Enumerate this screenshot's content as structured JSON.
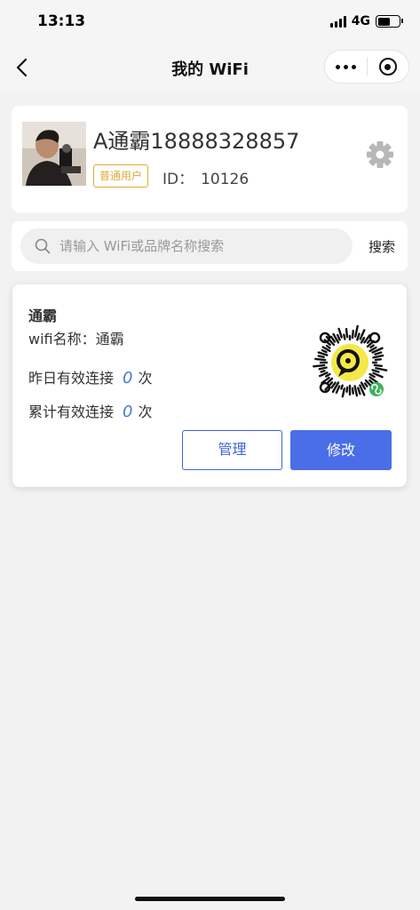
{
  "status_bar": {
    "time": "13:13",
    "network": "4G",
    "battery_level": 0.6
  },
  "nav": {
    "title": "我的 WiFi"
  },
  "profile": {
    "name": "A通霸18888328857",
    "badge": "普通用户",
    "id_label": "ID：",
    "id_value": "10126"
  },
  "search": {
    "placeholder": "请输入 WiFi或品牌名称搜索",
    "value": "",
    "button_label": "搜索"
  },
  "wifi_card": {
    "title": "通霸",
    "wifi_name_label": "wifi名称：",
    "wifi_name": "通霸",
    "yesterday_label": "昨日有效连接",
    "yesterday_count": "0",
    "total_label": "累计有效连接",
    "total_count": "0",
    "unit": "次",
    "manage_label": "管理",
    "edit_label": "修改"
  },
  "colors": {
    "accent": "#4a6ee8",
    "badge": "#e0a838",
    "count": "#4a78d0"
  }
}
